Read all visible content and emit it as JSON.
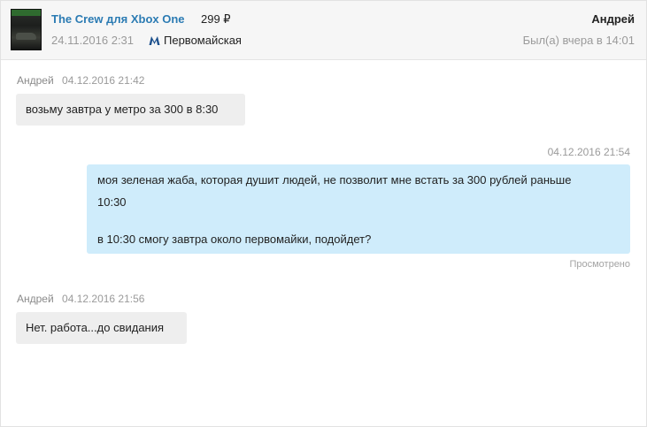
{
  "header": {
    "ad_title": "The Crew для Xbox One",
    "price": "299 ₽",
    "ad_date": "24.11.2016 2:31",
    "metro_station": "Первомайская",
    "user_name": "Андрей",
    "user_status": "Был(а) вчера в 14:01",
    "thumbnail_icon": "game-cover-thumbnail",
    "metro_icon": "metro-m-icon"
  },
  "messages": [
    {
      "direction": "incoming",
      "author": "Андрей",
      "time": "04.12.2016 21:42",
      "lines": [
        "возьму завтра у метро за 300 в 8:30"
      ]
    },
    {
      "direction": "outgoing",
      "time": "04.12.2016 21:54",
      "lines": [
        "моя зеленая жаба, которая душит людей,  не позволит мне встать за 300 рублей раньше",
        "10:30",
        "",
        "в 10:30 смогу завтра около первомайки, подойдет?"
      ],
      "status": "Просмотрено"
    },
    {
      "direction": "incoming",
      "author": "Андрей",
      "time": "04.12.2016 21:56",
      "lines": [
        "Нет. работа...до свидания"
      ]
    }
  ],
  "colors": {
    "link": "#2b7bb3",
    "outgoing_bubble": "#cfecfb",
    "incoming_bubble": "#eeeeee",
    "muted_text": "#9a9a9a"
  }
}
